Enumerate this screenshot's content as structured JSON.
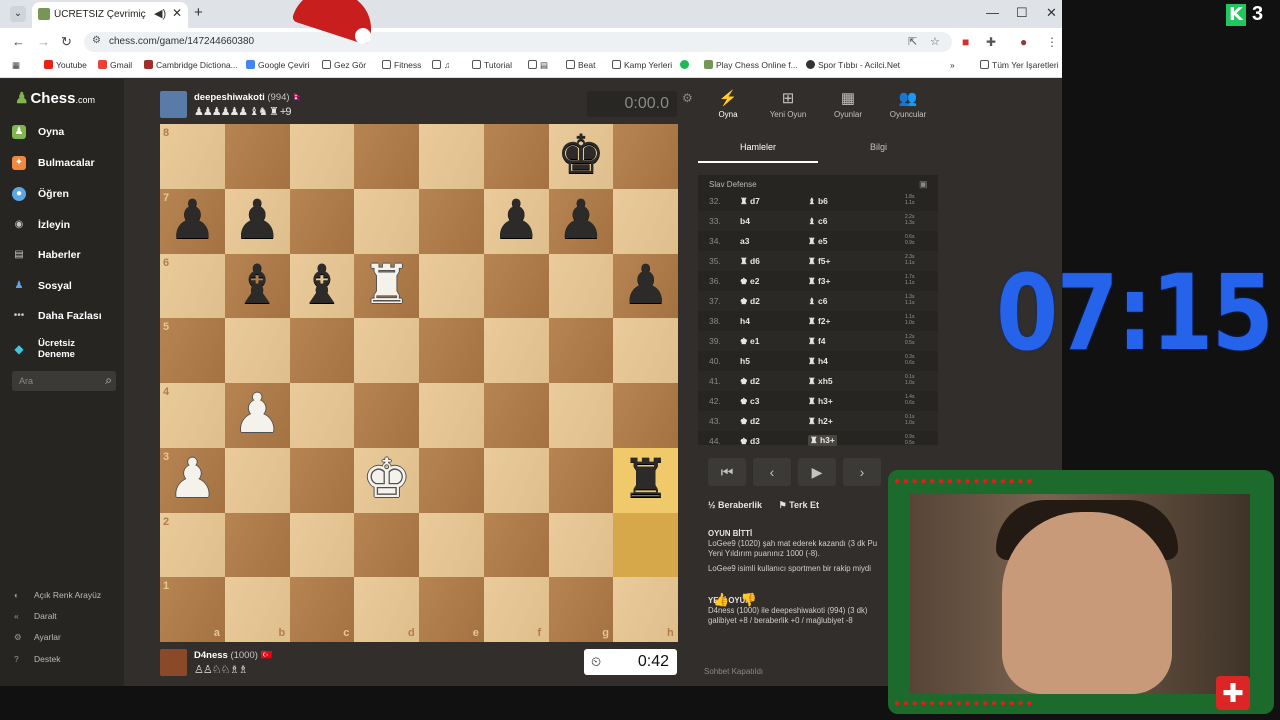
{
  "browser": {
    "tab_title": "ÜCRETSİZ Çevrimiçi Satranç",
    "url": "chess.com/game/147244660380",
    "bookmarks": [
      "Youtube",
      "Gmail",
      "Cambridge Dictiona...",
      "Google Çeviri",
      "Gez Gör",
      "Fitness",
      "",
      "Tutorial",
      "",
      "Beat",
      "Kamp Yerleri",
      "",
      "Play Chess Online f...",
      "Spor Tıbbı - Acilci.Net"
    ],
    "bookmarks_more": "»",
    "all_bookmarks": "Tüm Yer İşaretleri"
  },
  "sidebar": {
    "logo": "Chess",
    "logo_suffix": ".com",
    "items": [
      {
        "label": "Oyna",
        "color": "#81b64c"
      },
      {
        "label": "Bulmacalar",
        "color": "#f0883e"
      },
      {
        "label": "Öğren",
        "color": "#5aa7e8"
      },
      {
        "label": "İzleyin",
        "color": "#c7c6c5"
      },
      {
        "label": "Haberler",
        "color": "#c7c6c5"
      },
      {
        "label": "Sosyal",
        "color": "#5aa7e8"
      },
      {
        "label": "Daha Fazlası",
        "color": "#c7c6c5"
      },
      {
        "label": "Ücretsiz Deneme",
        "color": "#3cc9e0"
      }
    ],
    "search_placeholder": "Ara",
    "bottom": [
      {
        "label": "Açık Renk Arayüz",
        "icon": "◐"
      },
      {
        "label": "Daralt",
        "icon": "«"
      },
      {
        "label": "Ayarlar",
        "icon": "⚙"
      },
      {
        "label": "Destek",
        "icon": "?"
      }
    ]
  },
  "game": {
    "top_player": {
      "name": "deepeshiwakoti",
      "rating": "(994)",
      "flag": "🇳🇵",
      "captured": "♟♟♟♟♟♟ ♝♞ ♜ +9",
      "clock": "0:00.0"
    },
    "bottom_player": {
      "name": "D4ness",
      "rating": "(1000)",
      "flag": "🇹🇷",
      "captured": "♙♙♘♘♗♗",
      "clock": "0:42"
    },
    "files": [
      "a",
      "b",
      "c",
      "d",
      "e",
      "f",
      "g",
      "h"
    ],
    "ranks": [
      "8",
      "7",
      "6",
      "5",
      "4",
      "3",
      "2",
      "1"
    ],
    "highlights": [
      "h3",
      "h2"
    ],
    "pieces": [
      {
        "sq": "g8",
        "glyph": "♚",
        "color": "b"
      },
      {
        "sq": "a7",
        "glyph": "♟",
        "color": "b"
      },
      {
        "sq": "b7",
        "glyph": "♟",
        "color": "b"
      },
      {
        "sq": "f7",
        "glyph": "♟",
        "color": "b"
      },
      {
        "sq": "g7",
        "glyph": "♟",
        "color": "b"
      },
      {
        "sq": "b6",
        "glyph": "♝",
        "color": "b"
      },
      {
        "sq": "c6",
        "glyph": "♝",
        "color": "b"
      },
      {
        "sq": "d6",
        "glyph": "♜",
        "color": "w"
      },
      {
        "sq": "h6",
        "glyph": "♟",
        "color": "b"
      },
      {
        "sq": "b4",
        "glyph": "♟",
        "color": "w"
      },
      {
        "sq": "a3",
        "glyph": "♟",
        "color": "w"
      },
      {
        "sq": "d3",
        "glyph": "♚",
        "color": "w"
      },
      {
        "sq": "h3",
        "glyph": "♜",
        "color": "b"
      }
    ]
  },
  "panel": {
    "tabs": [
      {
        "label": "Oyna",
        "icon": "⚡"
      },
      {
        "label": "Yeni Oyun",
        "icon": "⊞"
      },
      {
        "label": "Oyunlar",
        "icon": "▦"
      },
      {
        "label": "Oyuncular",
        "icon": "👥"
      }
    ],
    "subtabs": [
      "Hamleler",
      "Bilgi"
    ],
    "opening": "Slav Defense",
    "moves": [
      {
        "n": "32.",
        "w": "♜ d7",
        "b": "♝ b6",
        "tw": "1.8s",
        "tb": "1.1s"
      },
      {
        "n": "33.",
        "w": "b4",
        "b": "♝ c6",
        "tw": "2.2s",
        "tb": "1.3s"
      },
      {
        "n": "34.",
        "w": "a3",
        "b": "♜ e5",
        "tw": "0.6s",
        "tb": "0.9s"
      },
      {
        "n": "35.",
        "w": "♜ d6",
        "b": "♜ f5+",
        "tw": "2.3s",
        "tb": "1.1s"
      },
      {
        "n": "36.",
        "w": "♚ e2",
        "b": "♜ f3+",
        "tw": "1.7s",
        "tb": "1.1s"
      },
      {
        "n": "37.",
        "w": "♚ d2",
        "b": "♝ c6",
        "tw": "1.3s",
        "tb": "1.1s"
      },
      {
        "n": "38.",
        "w": "h4",
        "b": "♜ f2+",
        "tw": "1.1s",
        "tb": "1.0s"
      },
      {
        "n": "39.",
        "w": "♚ e1",
        "b": "♜ f4",
        "tw": "1.2s",
        "tb": "0.5s"
      },
      {
        "n": "40.",
        "w": "h5",
        "b": "♜ h4",
        "tw": "0.3s",
        "tb": "0.6s"
      },
      {
        "n": "41.",
        "w": "♚ d2",
        "b": "♜ xh5",
        "tw": "0.1s",
        "tb": "1.0s"
      },
      {
        "n": "42.",
        "w": "♚ c3",
        "b": "♜ h3+",
        "tw": "1.4s",
        "tb": "0.6s"
      },
      {
        "n": "43.",
        "w": "♚ d2",
        "b": "♜ h2+",
        "tw": "0.1s",
        "tb": "1.0s"
      },
      {
        "n": "44.",
        "w": "♚ d3",
        "b": "♜ h3+",
        "tw": "0.9s",
        "tb": "0.5s"
      }
    ],
    "controls": [
      "⏮",
      "‹",
      "▶",
      "›"
    ],
    "draw_label": "Beraberlik",
    "draw_icon": "½",
    "resign_label": "Terk Et",
    "chat": {
      "over_title": "OYUN BİTTİ",
      "over_line1": "LoGee9 (1020) şah mat ederek kazandı (3 dk Pu",
      "over_line2": "Yeni Yıldırım puanınız 1000 (-8).",
      "sport_line": "LoGee9 isimli kullanıcı sportmen bir rakip miydi",
      "new_title": "YENİ OYUN",
      "new_line1": "D4ness (1000) ile deepeshiwakoti (994) (3 dk)",
      "new_line2": "galibiyet +8 / beraberlik +0 / mağlubiyet -8"
    },
    "chat_closed": "Sohbet Kapatıldı"
  },
  "overlay": {
    "k_logo": "K",
    "k_count": "3",
    "timer": "07:15"
  }
}
